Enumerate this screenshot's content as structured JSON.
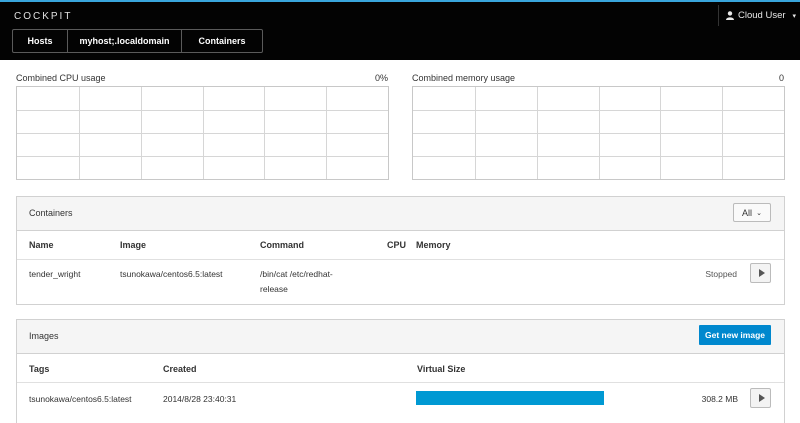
{
  "app": {
    "brand": "COCKPIT",
    "user": "Cloud User",
    "accent": "#39a5dc"
  },
  "breadcrumbs": [
    "Hosts",
    "myhost;.localdomain",
    "Containers"
  ],
  "gauges": {
    "cpu": {
      "label": "Combined CPU usage",
      "value": "0%"
    },
    "memory": {
      "label": "Combined memory usage",
      "value": "0"
    }
  },
  "containers": {
    "title": "Containers",
    "filter": "All",
    "columns": [
      "Name",
      "Image",
      "Command",
      "CPU",
      "Memory"
    ],
    "rows": [
      {
        "name": "tender_wright",
        "image": "tsunokawa/centos6.5:latest",
        "command_line1": "/bin/cat /etc/redhat-",
        "command_line2": "release",
        "status": "Stopped"
      }
    ]
  },
  "images": {
    "title": "Images",
    "new_button": "Get new image",
    "columns": [
      "Tags",
      "Created",
      "Virtual Size"
    ],
    "rows": [
      {
        "tag": "tsunokawa/centos6.5:latest",
        "created": "2014/8/28 23:40:31",
        "size": "308.2 MB",
        "size_fraction": 1.0
      }
    ],
    "bar_color": "#0099d3"
  }
}
